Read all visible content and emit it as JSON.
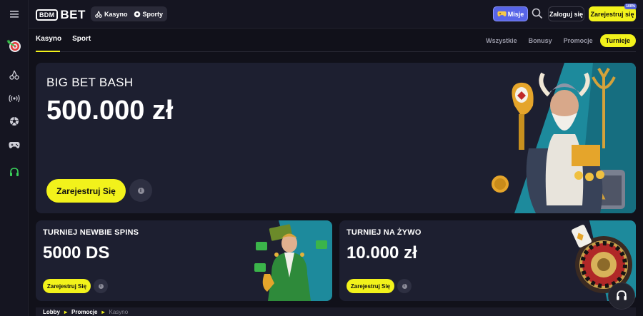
{
  "sidebar": {
    "icons": [
      "menu-icon",
      "darts-icon",
      "cherry-icon",
      "live-signal-icon",
      "soccer-ball-icon",
      "gamepad-icon",
      "headset-icon"
    ]
  },
  "header": {
    "logo_box": "BDM",
    "logo_text": "BET",
    "modes": [
      {
        "label": "Kasyno",
        "icon": "cherry-icon"
      },
      {
        "label": "Sporty",
        "icon": "soccer-ball-icon"
      }
    ],
    "missions_label": "Misje",
    "login_label": "Zaloguj się",
    "register_label": "Zarejestruj się",
    "register_badge": "100%"
  },
  "tabs": [
    "Kasyno",
    "Sport"
  ],
  "filters": [
    "Wszystkie",
    "Bonusy",
    "Promocje",
    "Turnieje"
  ],
  "active_filter": "Turnieje",
  "hero": {
    "subtitle": "BIG BET BASH",
    "title": "500.000 zł",
    "button": "Zarejestruj Się",
    "info": "i"
  },
  "cards": [
    {
      "subtitle": "TURNIEJ NEWBIE SPINS",
      "title": "5000 DS",
      "button": "Zarejestruj Się",
      "info": "i"
    },
    {
      "subtitle": "TURNIEJ NA ŻYWO",
      "title": "10.000 zł",
      "button": "Zarejestruj Się",
      "info": "i"
    }
  ],
  "breadcrumbs": [
    "Lobby",
    "Promocje",
    "Kasyno"
  ],
  "colors": {
    "accent": "#f2f21b",
    "background": "#11111a",
    "panel": "#1d1f30",
    "missions": "#5865e8"
  }
}
